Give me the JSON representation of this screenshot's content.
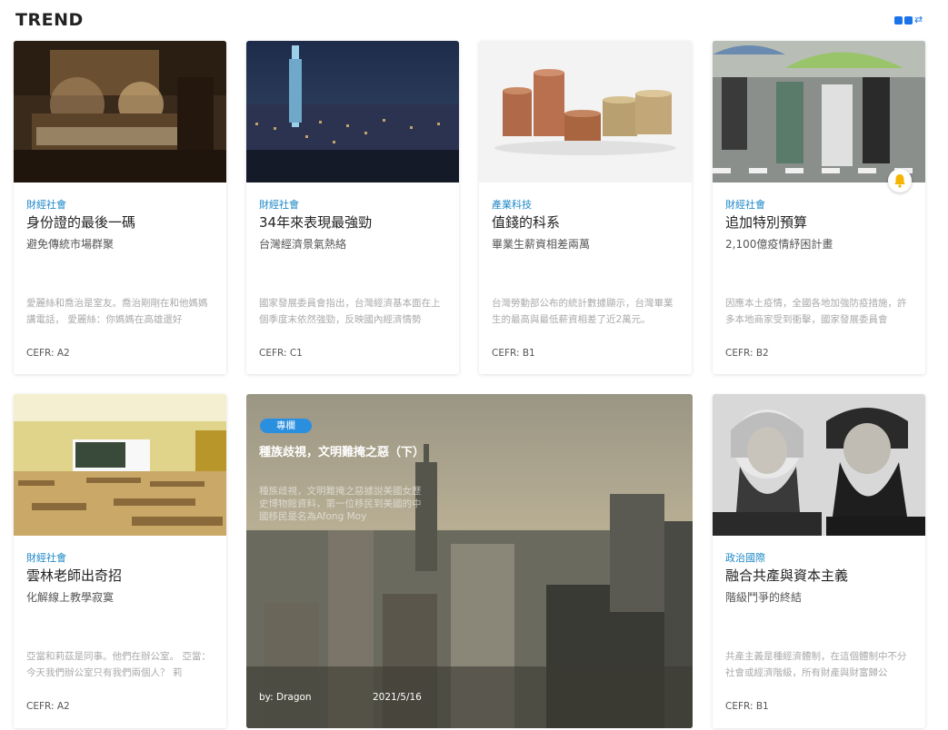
{
  "section": {
    "title": "TREND"
  },
  "view_toggle": {
    "icon": "grid-view-icon",
    "color": "#1a73e8"
  },
  "accent_color": "#1e88c7",
  "cards": [
    {
      "category": "財經社會",
      "title": "身份證的最後一碼",
      "subtitle": "避免傳統市場群聚",
      "excerpt": "愛麗絲和喬治是室友。喬治剛剛在和他媽媽講電話， 愛麗絲：你媽媽在高雄還好",
      "level": "CEFR: A2"
    },
    {
      "category": "財經社會",
      "title": "34年來表現最強勁",
      "subtitle": "台灣經濟景氣熱絡",
      "excerpt": "國家發展委員會指出，台灣經濟基本面在上個季度末依然強勁，反映國內經濟情勢",
      "level": "CEFR: C1"
    },
    {
      "category": "產業科技",
      "title": "值錢的科系",
      "subtitle": "畢業生薪資相差兩萬",
      "excerpt": "台灣勞動部公布的統計數據顯示，台灣畢業生的最高與最低薪資相差了近2萬元。",
      "level": "CEFR: B1"
    },
    {
      "category": "財經社會",
      "title": "追加特別預算",
      "subtitle": "2,100億疫情紓困計畫",
      "excerpt": "因應本土疫情，全國各地加強防疫措施，許多本地商家受到衝擊，國家發展委員會",
      "level": "CEFR: B2"
    },
    {
      "category": "財經社會",
      "title": "雲林老師出奇招",
      "subtitle": "化解線上教學寂寞",
      "excerpt": "亞當和莉茲是同事。他們在辦公室。 亞當：今天我們辦公室只有我們兩個人？ 莉",
      "level": "CEFR: A2"
    },
    {
      "category": "政治國際",
      "title": "融合共產與資本主義",
      "subtitle": "階級鬥爭的終結",
      "excerpt": "共產主義是種經濟體制，在這個體制中不分社會或經濟階級，所有財產與財富歸公",
      "level": "CEFR: B1"
    }
  ],
  "feature": {
    "badge": "專欄",
    "title": "種族歧視，文明難掩之惡（下）",
    "excerpt": "種族歧視，文明難掩之惡據說美國女歷史博物館資料，第一位移民到美國的中國移民是名為Afong Moy",
    "author": "by: Dragon",
    "date": "2021/5/16"
  }
}
